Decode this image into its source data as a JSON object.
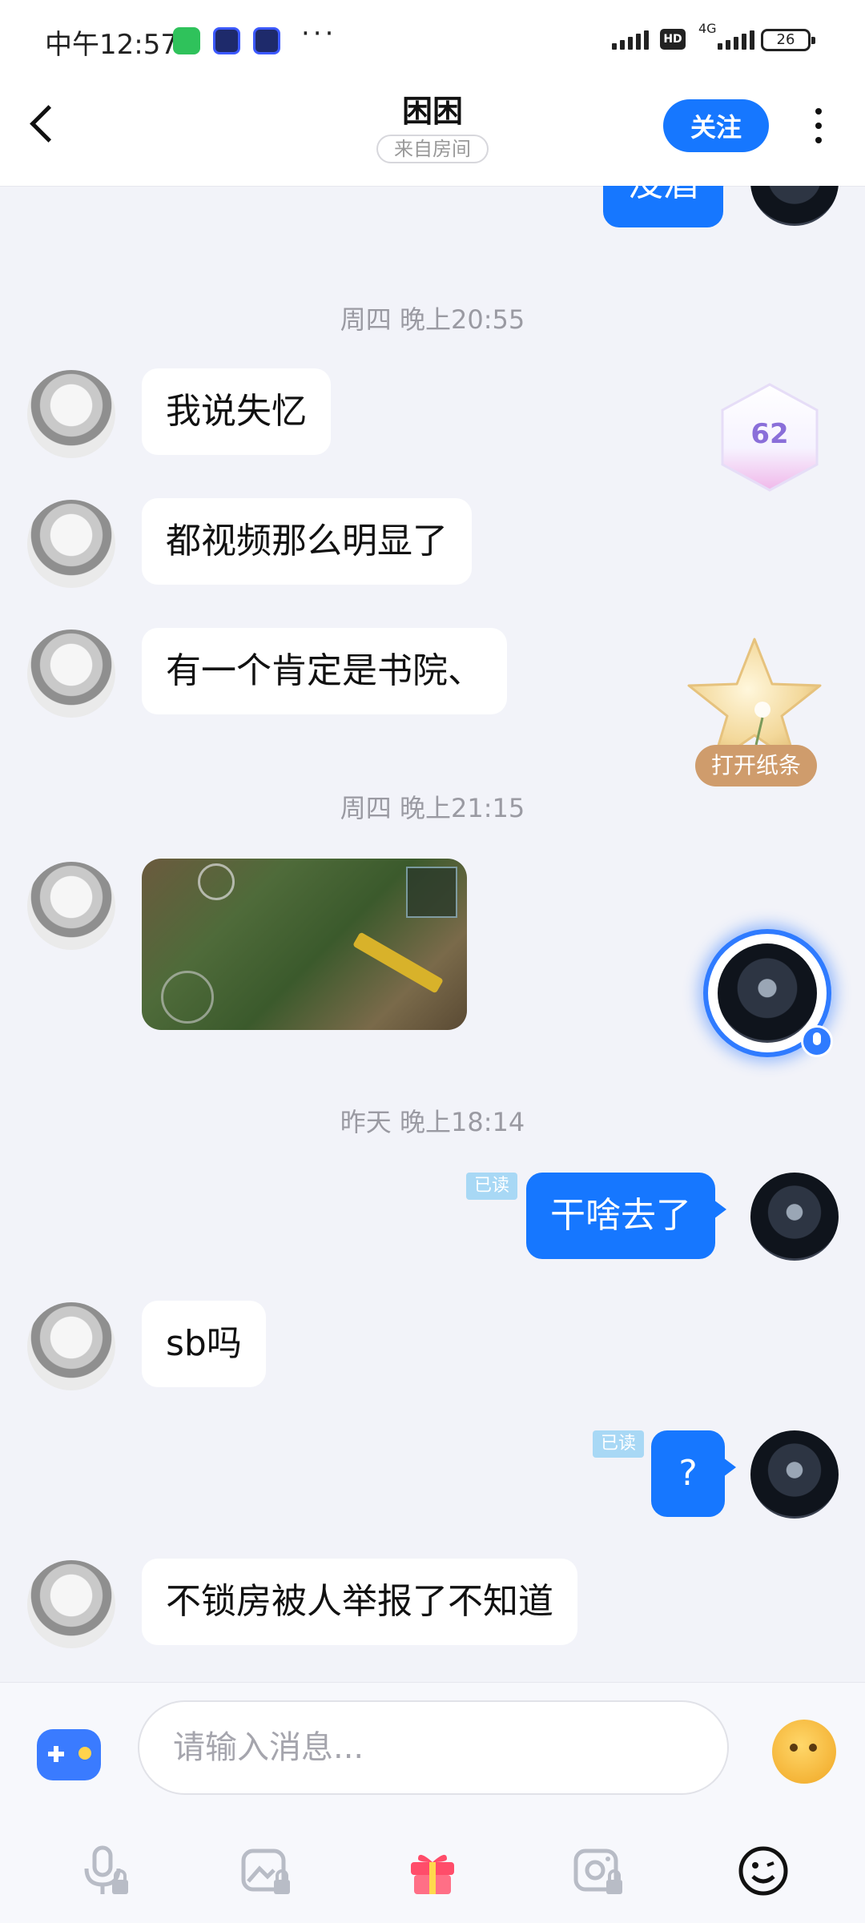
{
  "status_bar": {
    "time": "中午12:57",
    "dots": "···",
    "hd": "HD",
    "network": "4G",
    "battery": "26"
  },
  "header": {
    "title": "困困",
    "room_tag": "来自房间",
    "follow_label": "关注"
  },
  "messages": {
    "partial_out": "没酒",
    "time_1": "周四 晚上20:55",
    "m1": "我说失忆",
    "m2": "都视频那么明显了",
    "m3": "有一个肯定是书院、",
    "time_2": "周四 晚上21:15",
    "time_3": "昨天 晚上18:14",
    "m4": "干啥去了",
    "m4_status": "已读",
    "m5": "sb吗",
    "m6": "?",
    "m6_status": "已读",
    "m7": "不锁房被人举报了不知道"
  },
  "widgets": {
    "hex_value": "62",
    "star_label": "打开纸条"
  },
  "input": {
    "placeholder": "请输入消息..."
  },
  "icons": {
    "back": "back-arrow-icon",
    "more": "more-vertical-icon",
    "game": "gamepad-icon",
    "emoji": "emoji-sticker-icon",
    "voice": "voice-locked-icon",
    "album": "album-locked-icon",
    "gift": "gift-icon",
    "camera": "camera-locked-icon",
    "smile": "smile-icon"
  }
}
